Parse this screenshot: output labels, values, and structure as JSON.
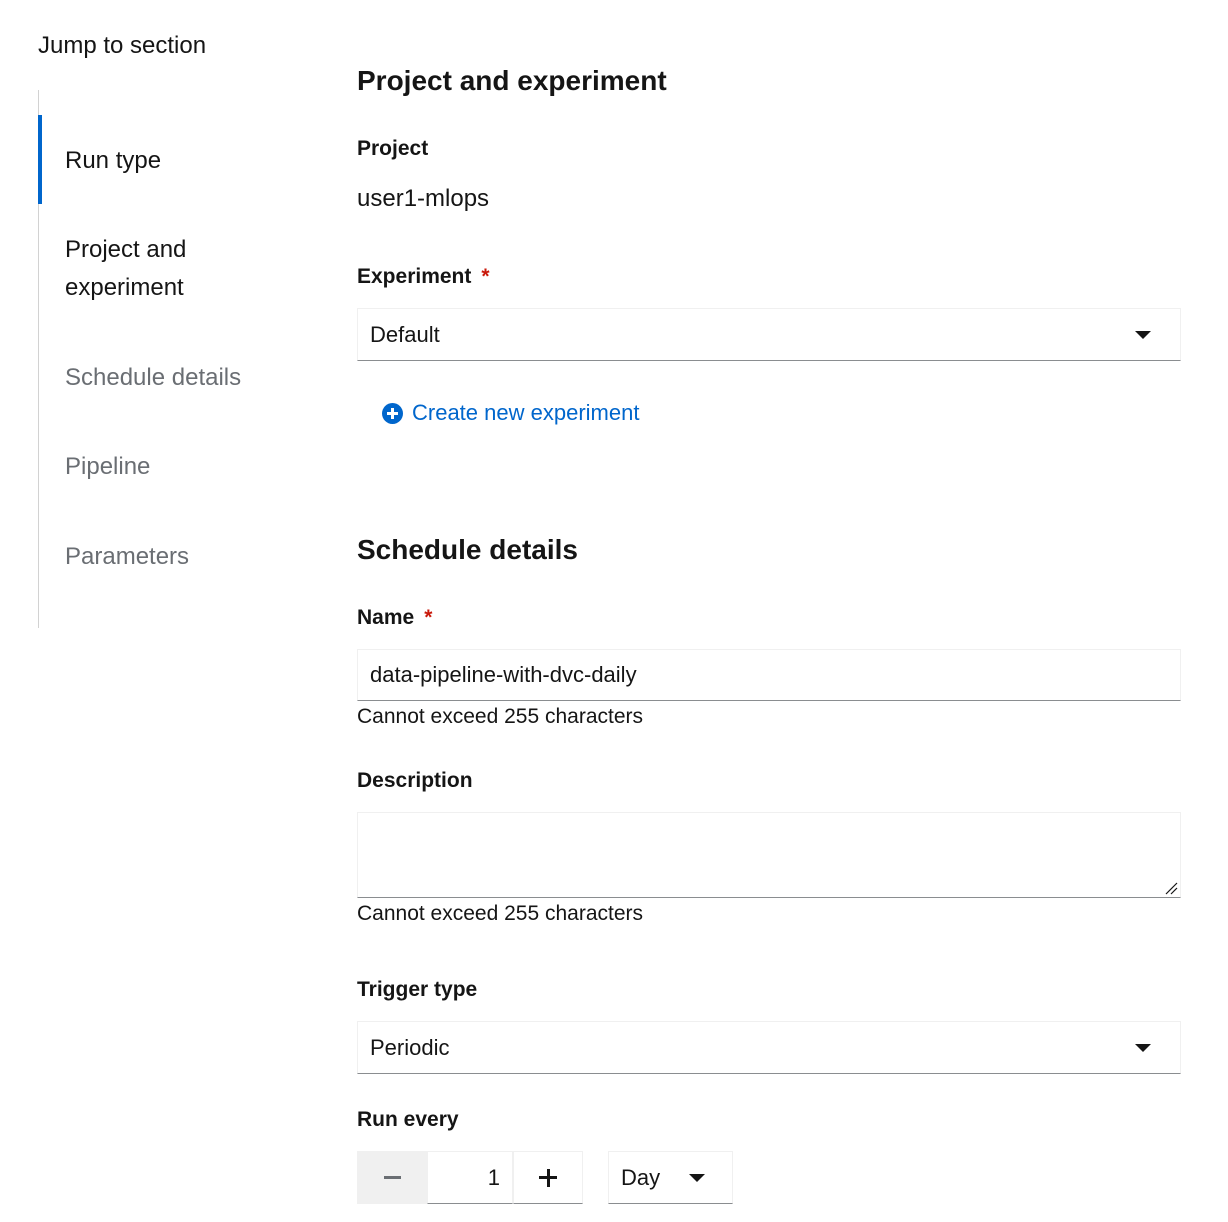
{
  "jump": {
    "title": "Jump to section",
    "items": [
      {
        "label": "Run type"
      },
      {
        "label": "Project and experiment"
      },
      {
        "label": "Schedule details"
      },
      {
        "label": "Pipeline"
      },
      {
        "label": "Parameters"
      }
    ]
  },
  "project_section": {
    "title": "Project and experiment",
    "project_label": "Project",
    "project_value": "user1-mlops",
    "experiment_label": "Experiment",
    "required_mark": "*",
    "experiment_selected": "Default",
    "create_experiment_link": "Create new experiment"
  },
  "schedule_section": {
    "title": "Schedule details",
    "name_label": "Name",
    "name_value": "data-pipeline-with-dvc-daily",
    "name_helper": "Cannot exceed 255 characters",
    "description_label": "Description",
    "description_value": "",
    "description_helper": "Cannot exceed 255 characters",
    "trigger_label": "Trigger type",
    "trigger_selected": "Periodic",
    "run_every_label": "Run every",
    "run_every_value": "1",
    "run_every_unit": "Day"
  },
  "colors": {
    "accent": "#0066cc",
    "required": "#c9190b",
    "muted_text": "#6a6e73"
  },
  "icons": {
    "create_experiment": "plus-circle-icon",
    "dropdown": "caret-down-icon",
    "decrement": "minus-icon",
    "increment": "plus-icon"
  }
}
